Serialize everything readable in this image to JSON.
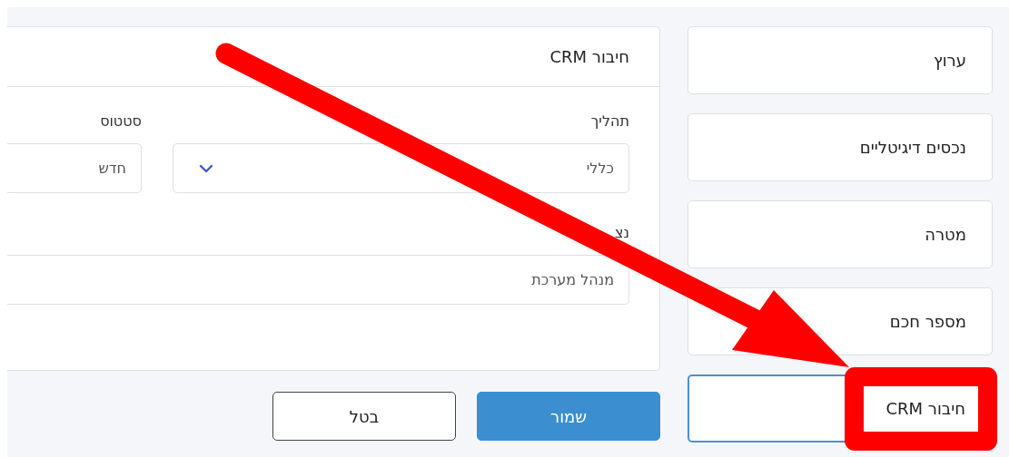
{
  "sidebar": {
    "items": [
      {
        "label": "ערוץ",
        "selected": false
      },
      {
        "label": "נכסים דיגיטליים",
        "selected": false
      },
      {
        "label": "מטרה",
        "selected": false
      },
      {
        "label": "מספר חכם",
        "selected": false
      },
      {
        "label": "חיבור CRM",
        "selected": true
      }
    ]
  },
  "panel": {
    "title": "חיבור CRM",
    "fields": [
      {
        "kind": "select",
        "label": "תהליך",
        "value": "כללי",
        "wide": false
      },
      {
        "kind": "text",
        "label": "סטטוס",
        "value": "חדש",
        "wide": false
      },
      {
        "kind": "text",
        "label": "נצ",
        "value": "מנהל מערכת",
        "wide": true
      }
    ]
  },
  "buttons": [
    {
      "label": "שמור",
      "kind": "primary"
    },
    {
      "label": "בטל",
      "kind": "secondary"
    }
  ]
}
